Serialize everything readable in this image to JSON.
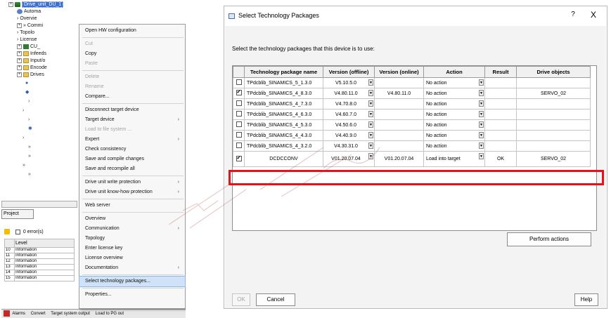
{
  "tree": {
    "items": [
      {
        "label": "Drive_unit_DU_1",
        "kind": "drive",
        "selected": true
      },
      {
        "label": "Automa",
        "kind": "gear"
      },
      {
        "label": "Overvie",
        "kind": "arrow"
      },
      {
        "label": "Commi",
        "kind": "arrow2"
      },
      {
        "label": "Topolo",
        "kind": "arrow"
      },
      {
        "label": "License",
        "kind": "arrow"
      },
      {
        "label": "CU_",
        "kind": "cu"
      },
      {
        "label": "Infeeds",
        "kind": "folder"
      },
      {
        "label": "Input/o",
        "kind": "folder"
      },
      {
        "label": "Encode",
        "kind": "folder"
      },
      {
        "label": "Drives",
        "kind": "folder"
      }
    ]
  },
  "project_tab": "Project",
  "errors": {
    "label": "0 error(s)",
    "level_header": "Level"
  },
  "log": {
    "rows": [
      {
        "no": "10",
        "level": "Information"
      },
      {
        "no": "11",
        "level": "Information"
      },
      {
        "no": "12",
        "level": "Information"
      },
      {
        "no": "13",
        "level": "Information"
      },
      {
        "no": "14",
        "level": "Information"
      },
      {
        "no": "15",
        "level": "Information"
      }
    ]
  },
  "status_bar": {
    "alarms": "Alarms",
    "tab2": "Convert",
    "tab3": "Target system output",
    "tab4": "Load to PG out"
  },
  "context_menu": {
    "items": [
      {
        "label": "Open HW configuration",
        "disabled": false,
        "submenu": false,
        "sep_after": true
      },
      {
        "label": "Cut",
        "disabled": true,
        "submenu": false
      },
      {
        "label": "Copy",
        "disabled": false,
        "submenu": false
      },
      {
        "label": "Paste",
        "disabled": true,
        "submenu": false,
        "sep_after": true
      },
      {
        "label": "Delete",
        "disabled": true,
        "submenu": false
      },
      {
        "label": "Rename",
        "disabled": true,
        "submenu": false
      },
      {
        "label": "Compare...",
        "disabled": false,
        "submenu": false,
        "sep_after": true
      },
      {
        "label": "Disconnect target device",
        "disabled": false,
        "submenu": false
      },
      {
        "label": "Target device",
        "disabled": false,
        "submenu": true
      },
      {
        "label": "Load to file system ...",
        "disabled": true,
        "submenu": false
      },
      {
        "label": "Expert",
        "disabled": false,
        "submenu": true
      },
      {
        "label": "Check consistency",
        "disabled": false,
        "submenu": false
      },
      {
        "label": "Save and compile changes",
        "disabled": false,
        "submenu": false
      },
      {
        "label": "Save and recompile all",
        "disabled": false,
        "submenu": false,
        "sep_after": true
      },
      {
        "label": "Drive unit write protection",
        "disabled": false,
        "submenu": true
      },
      {
        "label": "Drive unit know-how protection",
        "disabled": false,
        "submenu": true,
        "sep_after": true
      },
      {
        "label": "Web server",
        "disabled": false,
        "submenu": false,
        "sep_after": true
      },
      {
        "label": "Overview",
        "disabled": false,
        "submenu": false
      },
      {
        "label": "Communication",
        "disabled": false,
        "submenu": true
      },
      {
        "label": "Topology",
        "disabled": false,
        "submenu": false
      },
      {
        "label": "Enter license key",
        "disabled": false,
        "submenu": false
      },
      {
        "label": "License overview",
        "disabled": false,
        "submenu": false
      },
      {
        "label": "Documentation",
        "disabled": false,
        "submenu": true,
        "sep_after": true
      },
      {
        "label": "Select technology packages...",
        "disabled": false,
        "submenu": false,
        "highlighted": true,
        "sep_after": true
      },
      {
        "label": "Properties...",
        "disabled": false,
        "submenu": false
      }
    ]
  },
  "dialog": {
    "title": "Select Technology Packages",
    "help_glyph": "?",
    "close_glyph": "X",
    "instruction": "Select the technology packages that this device is to use:",
    "columns": [
      "Technology package name",
      "Version (offline)",
      "Version (online)",
      "Action",
      "Result",
      "Drive objects"
    ],
    "rows": [
      {
        "checked": false,
        "name": "TPdcblib_SINAMICS_5_1.3.0",
        "offline": "V5.10.5.0",
        "online": "",
        "action": "No action",
        "result": "",
        "drive_objects": ""
      },
      {
        "checked": true,
        "name": "TPdcblib_SINAMICS_4_8.3.0",
        "offline": "V4.80.11.0",
        "online": "V4.80.11.0",
        "action": "No action",
        "result": "",
        "drive_objects": "SERVO_02"
      },
      {
        "checked": false,
        "name": "TPdcblib_SINAMICS_4_7.3.0",
        "offline": "V4.70.8.0",
        "online": "",
        "action": "No action",
        "result": "",
        "drive_objects": ""
      },
      {
        "checked": false,
        "name": "TPdcblib_SINAMICS_4_6.3.0",
        "offline": "V4.60.7.0",
        "online": "",
        "action": "No action",
        "result": "",
        "drive_objects": ""
      },
      {
        "checked": false,
        "name": "TPdcblib_SINAMICS_4_5.3.0",
        "offline": "V4.50.6.0",
        "online": "",
        "action": "No action",
        "result": "",
        "drive_objects": ""
      },
      {
        "checked": false,
        "name": "TPdcblib_SINAMICS_4_4.3.0",
        "offline": "V4.40.9.0",
        "online": "",
        "action": "No action",
        "result": "",
        "drive_objects": ""
      },
      {
        "checked": false,
        "name": "TPdcblib_SINAMICS_4_3.2.0",
        "offline": "V4.30.31.0",
        "online": "",
        "action": "No action",
        "result": "",
        "drive_objects": ""
      },
      {
        "checked": true,
        "name": "DCDCCONV",
        "offline": "V01.20.07.04",
        "online": "V01.20.07.04",
        "action": "Load into target",
        "result": "OK",
        "drive_objects": "SERVO_02"
      }
    ],
    "perform_label": "Perform actions",
    "ok_label": "OK",
    "cancel_label": "Cancel",
    "help_label": "Help"
  },
  "colors": {
    "highlight_box": "#e0141a",
    "menu_highlight": "#cfe2f7",
    "selection": "#3b6fd0"
  }
}
